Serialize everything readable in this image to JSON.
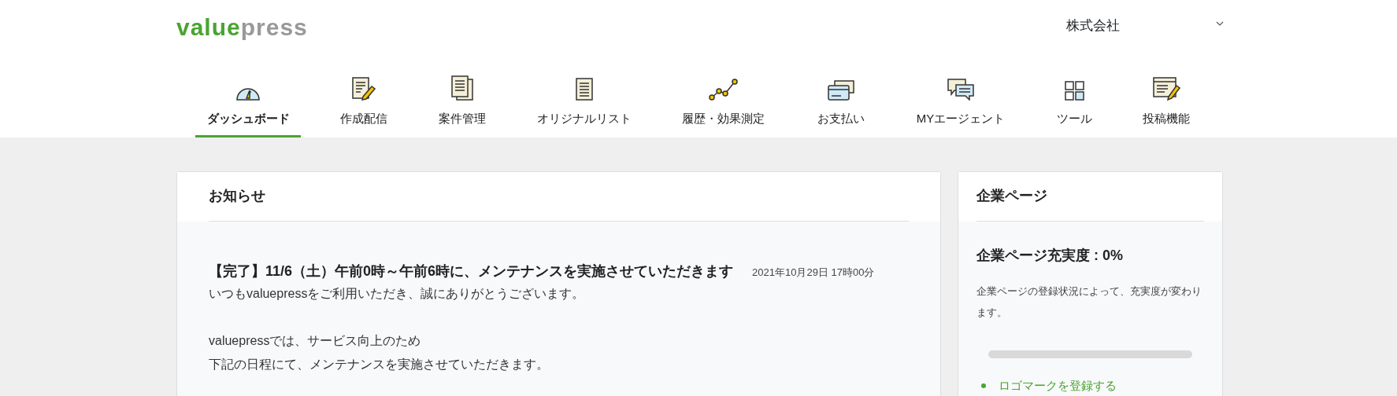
{
  "header": {
    "logo": {
      "primary": "value",
      "secondary": "press"
    },
    "account": {
      "label": "株式会社"
    }
  },
  "nav": [
    {
      "label": "ダッシュボード",
      "kind": "gauge",
      "selected": true
    },
    {
      "label": "作成配信",
      "kind": "compose",
      "selected": false
    },
    {
      "label": "案件管理",
      "kind": "docs",
      "selected": false
    },
    {
      "label": "オリジナルリスト",
      "kind": "list",
      "selected": false
    },
    {
      "label": "履歴・効果測定",
      "kind": "history",
      "selected": false
    },
    {
      "label": "お支払い",
      "kind": "payment",
      "selected": false
    },
    {
      "label": "MYエージェント",
      "kind": "agent",
      "selected": false
    },
    {
      "label": "ツール",
      "kind": "tools",
      "selected": false
    },
    {
      "label": "投稿機能",
      "kind": "post",
      "selected": false
    }
  ],
  "notices": {
    "title": "お知らせ",
    "items": [
      {
        "title": "【完了】11/6（土）午前0時～午前6時に、メンテナンスを実施させていただきます",
        "date": "2021年10月29日 17時00分",
        "paragraphs": [
          [
            "いつもvaluepressをご利用いただき、誠にありがとうございます。"
          ],
          [
            "valuepressでは、サービス向上のため",
            "下記の日程にて、メンテナンスを実施させていただきます。"
          ]
        ]
      }
    ]
  },
  "company_page": {
    "title": "企業ページ",
    "completion": "企業ページ充実度 : 0%",
    "description": "企業ページの登録状況によって、充実度が変わります。",
    "progress": {
      "level": 0
    },
    "tasks": [
      {
        "label": "ロゴマークを登録する"
      }
    ]
  }
}
